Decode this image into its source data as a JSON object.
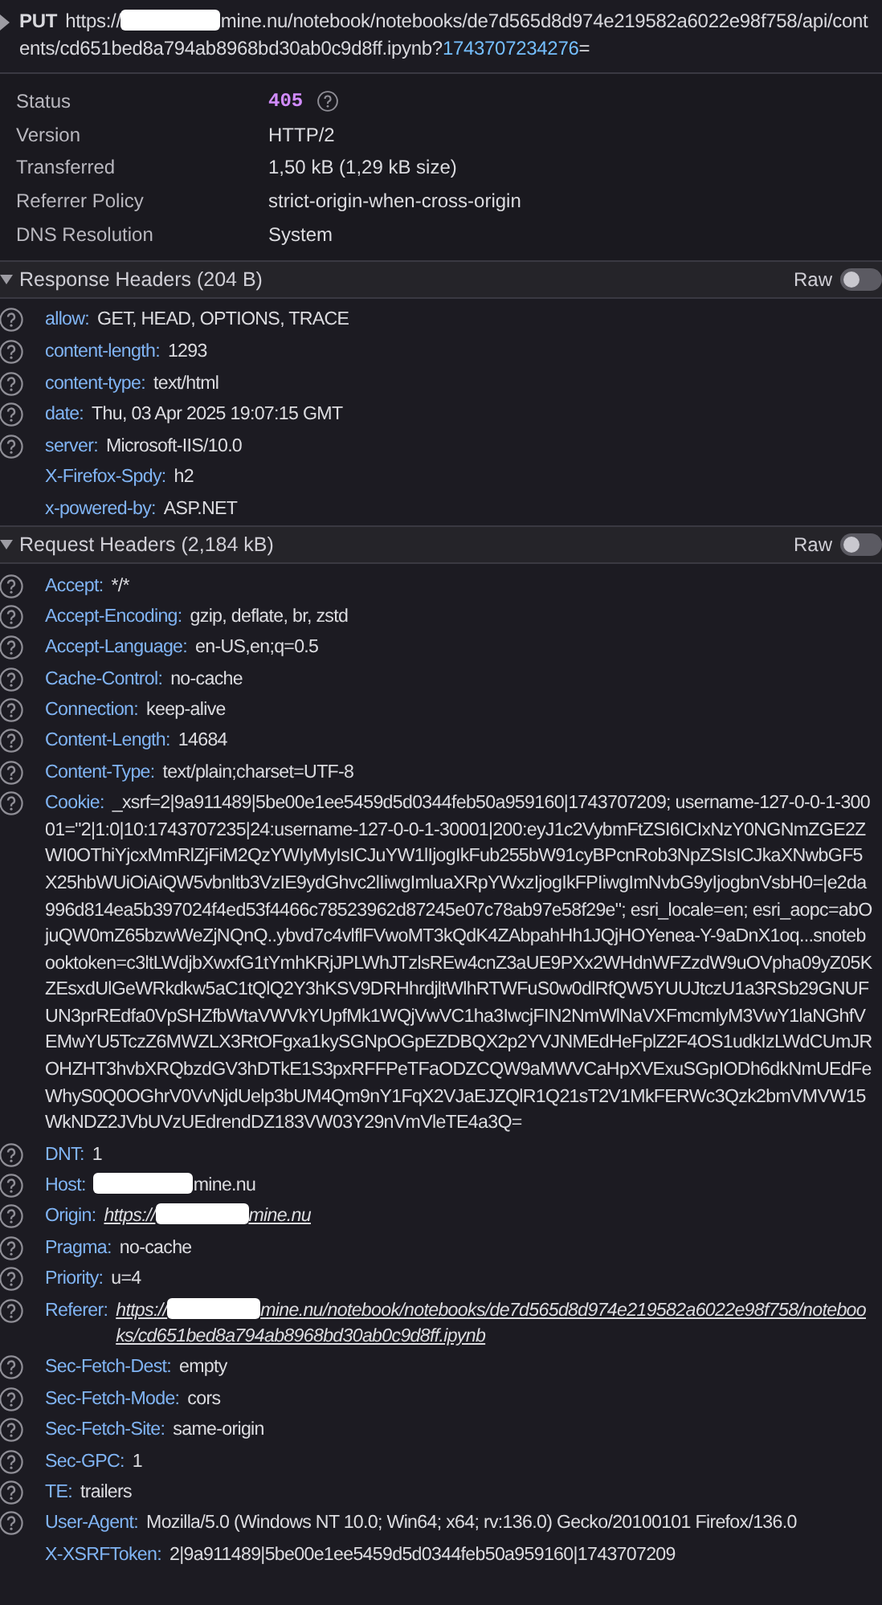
{
  "request": {
    "method": "PUT",
    "url_start": "https://",
    "redacted": true,
    "url": "mine.nu/notebook/notebooks/de7d565d8d974e219582a6022e98f758/api/contents/cd651bed8a794ab8968bd30ab0c9d8ff.ipynb?",
    "query": "1743707234276",
    "query_end": "="
  },
  "summary": [
    {
      "label": "Status",
      "value": "405",
      "kind": "status",
      "help_icon": true
    },
    {
      "label": "Version",
      "value": "HTTP/2",
      "kind": "text"
    },
    {
      "label": "Transferred",
      "value": "1,50 kB (1,29 kB size)",
      "kind": "text"
    },
    {
      "label": "Referrer Policy",
      "value": "strict-origin-when-cross-origin",
      "kind": "text"
    },
    {
      "label": "DNS Resolution",
      "value": "System",
      "kind": "text"
    }
  ],
  "sections": [
    {
      "title": "Response Headers (204 B)",
      "expanded": true,
      "raw": {
        "label": "Raw",
        "on": false
      },
      "headers": [
        {
          "name": "allow:",
          "value": "GET, HEAD, OPTIONS, TRACE",
          "help_icon": true
        },
        {
          "name": "content-length:",
          "value": "1293",
          "help_icon": true
        },
        {
          "name": "content-type:",
          "value": "text/html",
          "help_icon": true
        },
        {
          "name": "date:",
          "value": "Thu, 03 Apr 2025 19:07:15 GMT",
          "help_icon": true
        },
        {
          "name": "server:",
          "value": "Microsoft-IIS/10.0",
          "help_icon": true
        },
        {
          "name": "X-Firefox-Spdy:",
          "value": "h2",
          "help_icon": false
        },
        {
          "name": "x-powered-by:",
          "value": "ASP.NET",
          "help_icon": false
        }
      ]
    },
    {
      "title": "Request Headers (2,184 kB)",
      "expanded": true,
      "raw": {
        "label": "Raw",
        "on": false
      },
      "headers": [
        {
          "name": "Accept:",
          "value": "*/*",
          "help_icon": true
        },
        {
          "name": "Accept-Encoding:",
          "value": "gzip, deflate, br, zstd",
          "help_icon": true
        },
        {
          "name": "Accept-Language:",
          "value": "en-US,en;q=0.5",
          "help_icon": true
        },
        {
          "name": "Cache-Control:",
          "value": "no-cache",
          "help_icon": true
        },
        {
          "name": "Connection:",
          "value": "keep-alive",
          "help_icon": true
        },
        {
          "name": "Content-Length:",
          "value": "14684",
          "help_icon": true
        },
        {
          "name": "Content-Type:",
          "value": "text/plain;charset=UTF-8",
          "help_icon": true
        },
        {
          "name": "Cookie:",
          "value": "_xsrf=2|9a911489|5be00e1ee5459d5d0344feb50a959160|1743707209; username-127-0-0-1-30001=\"2|1:0|10:1743707235|24:username-127-0-0-1-30001|200:eyJ1c2VybmFtZSI6ICIxNzY0NGNmZGE2ZWI0OThiYjcxMmRlZjFiM2QzYWIyMyIsICJuYW1lIjogIkFub255bW91cyBPcnRob3NpZSIsICJkaXNwbGF5X25hbWUiOiAiQW5vbnltb3VzIE9ydGhvc2lIiwgImluaXRpYWxzIjogIkFPIiwgImNvbG9yIjogbnVsbH0=|e2da996d814ea5b397024f4ed53f4466c78523962d87245e07c78ab97e58f29e\"; esri_locale=en; esri_aopc=abOjuQW0mZ65bzwWeZjNQnQ..ybvd7c4vlflFVwoMT3kQdK4ZAbpahHh1JQjHOYenea-Y-9aDnX1oq...snotebooktoken=c3ltLWdjbXwxfG1tYmhKRjJPLWhJTzlsREw4cnZ3aUE9PXx2WHdnWFZzdW9uOVpha09yZ05KZEsxdUlGeWRkdkw5aC1tQlQ2Y3hKSV9DRHhrdjltWlhRTWFuS0w0dlRfQW5YUUJtczU1a3RSb29GNUFUN3prREdfa0VpSHZfbWtaVWVkYUpfMk1WQjVwVC1ha3IwcjFIN2NmWlNaVXFmcmlyM3VwY1laNGhfVEMwYU5TczZ6MWZLX3RtOFgxa1kySGNpOGpEZDBQX2p2YVJNMEdHeFplZ2F4OS1udkIzLWdCUmJROHZHT3hvbXRQbzdGV3hDTkE1S3pxRFFPeTFaODZCQW9aMWVCaHpXVExuSGpIODh6dkNmUEdFeWhyS0Q0OGhrV0VvNjdUelp3bUM4Qm9nY1FqX2VJaEJZQlR1Q21sT2V1MkFERWc3Qzk2bmVMVW15WkNDZ2JVbUVzUEdrendDZ183VW03Y29nVmVleTE4a3Q=",
          "help_icon": true
        },
        {
          "name": "DNT:",
          "value": "1",
          "help_icon": true
        },
        {
          "name": "Host:",
          "redacted": true,
          "value": "mine.nu",
          "help_icon": true
        },
        {
          "name": "Origin:",
          "link": true,
          "value_start": "https://",
          "redacted": true,
          "value": "mine.nu",
          "help_icon": true
        },
        {
          "name": "Pragma:",
          "value": "no-cache",
          "help_icon": true
        },
        {
          "name": "Priority:",
          "value": "u=4",
          "help_icon": true
        },
        {
          "name": "Referer:",
          "link": true,
          "value_start": "https://",
          "redacted": true,
          "value": "mine.nu/notebook/notebooks/de7d565d8d974e219582a6022e98f758/notebooks/cd651bed8a794ab8968bd30ab0c9d8ff.ipynb",
          "help_icon": true
        },
        {
          "name": "Sec-Fetch-Dest:",
          "value": "empty",
          "help_icon": true
        },
        {
          "name": "Sec-Fetch-Mode:",
          "value": "cors",
          "help_icon": true
        },
        {
          "name": "Sec-Fetch-Site:",
          "value": "same-origin",
          "help_icon": true
        },
        {
          "name": "Sec-GPC:",
          "value": "1",
          "help_icon": true
        },
        {
          "name": "TE:",
          "value": "trailers",
          "help_icon": true
        },
        {
          "name": "User-Agent:",
          "value": "Mozilla/5.0 (Windows NT 10.0; Win64; x64; rv:136.0) Gecko/20100101 Firefox/136.0",
          "help_icon": true
        },
        {
          "name": "X-XSRFToken:",
          "value": "2|9a911489|5be00e1ee5459d5d0344feb50a959160|1743707209",
          "help_icon": false
        }
      ]
    }
  ]
}
